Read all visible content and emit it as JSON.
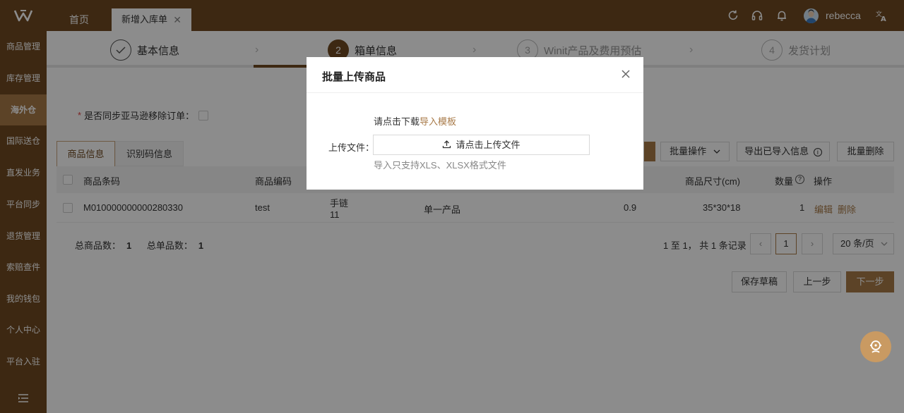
{
  "header": {
    "tabs": [
      {
        "label": "首页"
      },
      {
        "label": "新增入库单",
        "closable": true
      }
    ],
    "username": "rebecca",
    "icons": [
      "refresh-icon",
      "headset-icon",
      "bell-icon",
      "translate-icon"
    ]
  },
  "sidebar": {
    "items": [
      {
        "label": "商品管理"
      },
      {
        "label": "库存管理"
      },
      {
        "label": "海外仓",
        "active": true
      },
      {
        "label": "国际送仓"
      },
      {
        "label": "直发业务"
      },
      {
        "label": "平台同步"
      },
      {
        "label": "退货管理"
      },
      {
        "label": "索赔查件"
      },
      {
        "label": "我的钱包"
      },
      {
        "label": "个人中心"
      },
      {
        "label": "平台入驻"
      }
    ]
  },
  "steps": [
    {
      "num": "✓",
      "label": "基本信息",
      "state": "done"
    },
    {
      "num": "2",
      "label": "箱单信息",
      "state": "current"
    },
    {
      "num": "3",
      "label": "Winit产品及费用预估",
      "state": "todo"
    },
    {
      "num": "4",
      "label": "发货计划",
      "state": "todo"
    }
  ],
  "form": {
    "sync_label": "是否同步亚马逊移除订单："
  },
  "subtabs": [
    "商品信息",
    "识别码信息"
  ],
  "toolbar": {
    "batch_ops": "批量操作",
    "export": "导出已导入信息",
    "batch_delete": "批量删除"
  },
  "table": {
    "headers": {
      "barcode": "商品条码",
      "code": "商品编码",
      "size": "商品尺寸(cm)",
      "qty": "数量",
      "ops": "操作"
    },
    "rows": [
      {
        "barcode": "M010000000000280330",
        "code": "test",
        "name_line1": "手链",
        "name_line2": "11",
        "type": "单一产品",
        "weight": "0.9",
        "size": "35*30*18",
        "qty": "1",
        "edit": "编辑",
        "delete": "删除"
      }
    ]
  },
  "summary": {
    "total_label": "总商品数：",
    "total_value": "1",
    "single_label": "总单品数：",
    "single_value": "1"
  },
  "pagination": {
    "text": "1 至 1， 共 1 条记录",
    "current": "1",
    "page_size": "20 条/页"
  },
  "footer": {
    "save_draft": "保存草稿",
    "prev": "上一步",
    "next": "下一步"
  },
  "modal": {
    "title": "批量上传商品",
    "hint_prefix": "请点击下载",
    "hint_link": "导入模板",
    "upload_label": "上传文件：",
    "upload_button": "请点击上传文件",
    "note": "导入只支持XLS、XLSX格式文件"
  }
}
